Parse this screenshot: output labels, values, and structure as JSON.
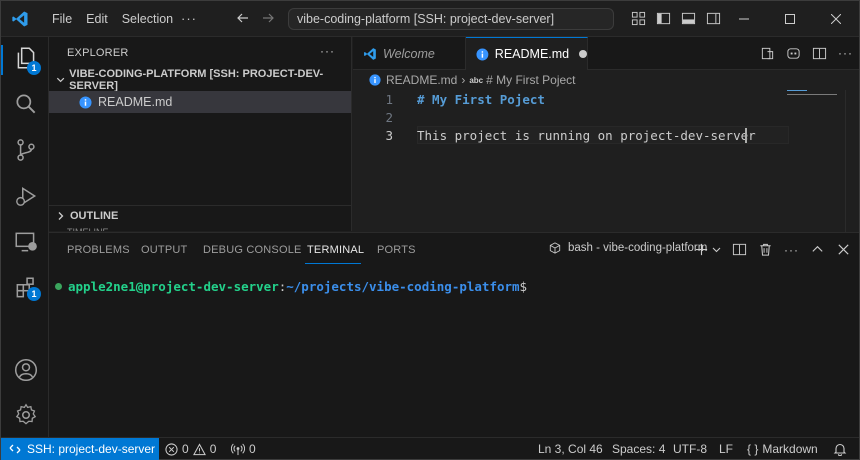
{
  "titlebar": {
    "menu": [
      "File",
      "Edit",
      "Selection",
      "···"
    ],
    "command_center": "vibe-coding-platform [SSH: project-dev-server]"
  },
  "activity": {
    "explorer_badge": "1",
    "extensions_badge": "1"
  },
  "sidebar": {
    "header": "EXPLORER",
    "more": "···",
    "folder": "VIBE-CODING-PLATFORM [SSH: PROJECT-DEV-SERVER]",
    "file": "README.md",
    "outline": "OUTLINE",
    "timeline": "TIMELINE"
  },
  "tabs": [
    {
      "label": "Welcome",
      "icon": "vscode-icon",
      "active": false
    },
    {
      "label": "README.md",
      "icon": "info-icon",
      "active": true,
      "dirty": true
    }
  ],
  "breadcrumb": {
    "file": "README.md",
    "symbol": "# My First Poject"
  },
  "editor": {
    "lines": [
      {
        "n": "1",
        "text": "# My First Poject"
      },
      {
        "n": "2",
        "text": ""
      },
      {
        "n": "3",
        "text": "This project is running on project-dev-server"
      }
    ],
    "current_line": 3
  },
  "panel": {
    "tabs": [
      "PROBLEMS",
      "OUTPUT",
      "DEBUG CONSOLE",
      "TERMINAL",
      "PORTS"
    ],
    "active_tab": "TERMINAL",
    "terminal_name": "bash - vibe-coding-platform",
    "prompt": {
      "user_host": "apple2ne1@project-dev-server",
      "colon": ":",
      "path": "~/projects/vibe-coding-platform",
      "dollar": "$"
    }
  },
  "statusbar": {
    "remote": "SSH: project-dev-server",
    "errors": "0",
    "warnings": "0",
    "ports": "0",
    "position": "Ln 3, Col 46",
    "spaces": "Spaces: 4",
    "encoding": "UTF-8",
    "eol": "LF",
    "language": "Markdown"
  },
  "colors": {
    "accent": "#0078d4",
    "heading": "#569cd6",
    "term_user": "#23d18b",
    "term_path": "#3b8eea"
  }
}
